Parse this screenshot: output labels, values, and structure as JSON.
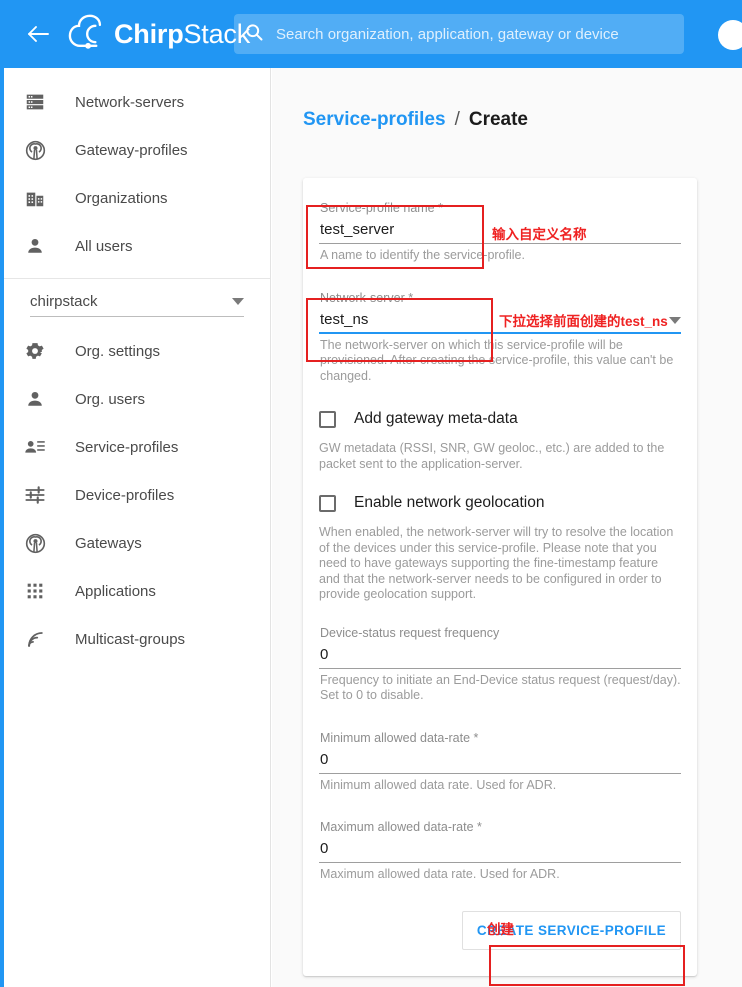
{
  "topbar": {
    "menu_toggle_icon": "collapse-arrow-left-icon",
    "brand_bold": "Chirp",
    "brand_light": "Stack",
    "brand_logo_icon": "chirpstack-cloud-icon",
    "search_icon": "search-icon",
    "search_value": "",
    "search_placeholder": "Search organization, application, gateway or device",
    "avatar_icon": "user-avatar-icon",
    "accent_color": "#2196f3"
  },
  "sidebar": {
    "global_items": [
      {
        "label": "Network-servers",
        "icon": "server-rack-icon"
      },
      {
        "label": "Gateway-profiles",
        "icon": "antenna-signal-icon"
      },
      {
        "label": "Organizations",
        "icon": "building-icon"
      },
      {
        "label": "All users",
        "icon": "person-icon"
      }
    ],
    "org_selector": {
      "value": "chirpstack",
      "caret_icon": "chevron-down-icon"
    },
    "org_items": [
      {
        "label": "Org. settings",
        "icon": "gear-icon"
      },
      {
        "label": "Org. users",
        "icon": "person-icon"
      },
      {
        "label": "Service-profiles",
        "icon": "person-list-icon"
      },
      {
        "label": "Device-profiles",
        "icon": "sliders-icon"
      },
      {
        "label": "Gateways",
        "icon": "antenna-signal-icon"
      },
      {
        "label": "Applications",
        "icon": "grid-dots-icon"
      },
      {
        "label": "Multicast-groups",
        "icon": "rss-broadcast-icon"
      }
    ]
  },
  "main": {
    "breadcrumb": {
      "link": "Service-profiles",
      "separator": "/",
      "current": "Create"
    },
    "form": {
      "fields": [
        {
          "label": "Service-profile name *",
          "value": "test_server",
          "hint": "A name to identify the service-profile."
        },
        {
          "label": "Network-server *",
          "value": "test_ns",
          "hint": "The network-server on which this service-profile will be provisioned. After creating the service-profile, this value can't be changed."
        }
      ],
      "checkboxes": [
        {
          "label": "Add gateway meta-data",
          "checked": false,
          "hint": "GW metadata (RSSI, SNR, GW geoloc., etc.) are added to the packet sent to the application-server."
        },
        {
          "label": "Enable network geolocation",
          "checked": false,
          "hint": "When enabled, the network-server will try to resolve the location of the devices under this service-profile. Please note that you need to have gateways supporting the fine-timestamp feature and that the network-server needs to be configured in order to provide geolocation support."
        }
      ],
      "numeric_fields": [
        {
          "label": "Device-status request frequency",
          "value": "0",
          "hint": "Frequency to initiate an End-Device status request (request/day). Set to 0 to disable."
        },
        {
          "label": "Minimum allowed data-rate *",
          "value": "0",
          "hint": "Minimum allowed data rate. Used for ADR."
        },
        {
          "label": "Maximum allowed data-rate *",
          "value": "0",
          "hint": "Maximum allowed data rate. Used for ADR."
        }
      ],
      "submit_label": "CREATE SERVICE-PROFILE"
    }
  },
  "annotations": {
    "color": "#ef2222",
    "name_field_note": "输入自定义名称",
    "network_server_note": "下拉选择前面创建的test_ns",
    "create_note": "创建"
  }
}
